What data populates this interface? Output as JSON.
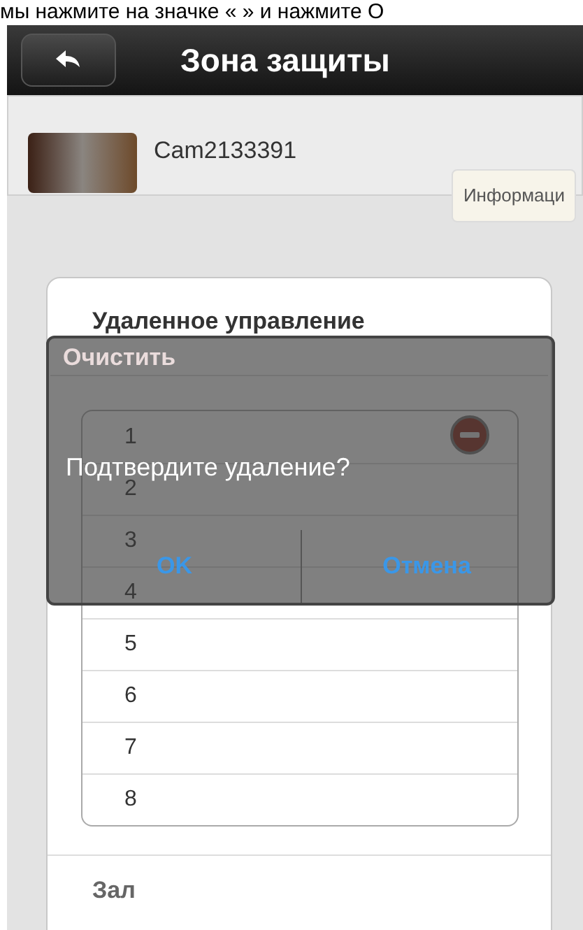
{
  "caption": "мы нажмите на значке «  » и нажмите О",
  "header": {
    "title": "Зона защиты"
  },
  "camera": {
    "name": "Cam2133391",
    "info_button": "Информаци"
  },
  "remote": {
    "title": "Удаленное управление",
    "clear_label": "Очистить",
    "items": [
      {
        "label": "1",
        "deletable": true
      },
      {
        "label": "2",
        "deletable": false
      },
      {
        "label": "3",
        "deletable": false
      },
      {
        "label": "4",
        "deletable": false
      },
      {
        "label": "5",
        "deletable": false
      },
      {
        "label": "6",
        "deletable": false
      },
      {
        "label": "7",
        "deletable": false
      },
      {
        "label": "8",
        "deletable": false
      }
    ]
  },
  "next_section": {
    "title": "Зал"
  },
  "dialog": {
    "message": "Подтвердите удаление?",
    "buttons": [
      "OK",
      "Отмена"
    ]
  }
}
